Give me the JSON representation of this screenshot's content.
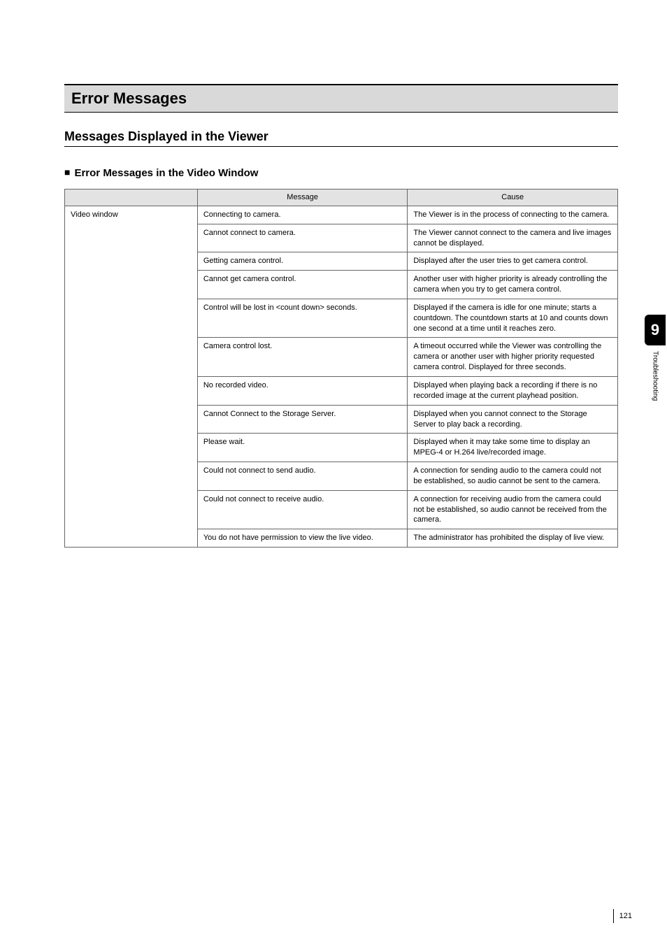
{
  "section_title": "Error Messages",
  "subsection_title": "Messages Displayed in the Viewer",
  "subsub_title": "Error Messages in the Video Window",
  "table": {
    "headers": [
      "",
      "Message",
      "Cause"
    ],
    "group_label": "Video window",
    "rows": [
      {
        "message": "Connecting to camera.",
        "cause": "The Viewer is in the process of connecting to the camera."
      },
      {
        "message": "Cannot connect to camera.",
        "cause": "The Viewer cannot connect to the camera and live images cannot be displayed."
      },
      {
        "message": "Getting camera control.",
        "cause": "Displayed after the user tries to get camera control."
      },
      {
        "message": "Cannot get camera control.",
        "cause": "Another user with higher priority is already controlling the camera when you try to get camera control."
      },
      {
        "message": "Control will be lost in <count down> seconds.",
        "cause": "Displayed if the camera is idle for one minute; starts a countdown. The countdown starts at 10 and counts down one second at a time until it reaches zero."
      },
      {
        "message": "Camera control lost.",
        "cause": "A timeout occurred while the Viewer was controlling the camera or another user with higher priority requested camera control. Displayed for three seconds."
      },
      {
        "message": "No recorded video.",
        "cause": "Displayed when playing back a recording if there is no recorded image at the current playhead position."
      },
      {
        "message": "Cannot Connect to the Storage Server.",
        "cause": "Displayed when you cannot connect to the Storage Server to play back a recording."
      },
      {
        "message": "Please wait.",
        "cause": "Displayed when it may take some time to display an MPEG-4 or H.264 live/recorded image."
      },
      {
        "message": "Could not connect to send audio.",
        "cause": "A connection for sending audio to the camera could not be established, so audio cannot be sent to the camera."
      },
      {
        "message": "Could not connect to receive audio.",
        "cause": "A connection for receiving audio from the camera could not be established, so audio cannot be received from the camera."
      },
      {
        "message": "You do not have permission to view the live video.",
        "cause": "The administrator has prohibited the display of live view."
      }
    ]
  },
  "side_tab": {
    "number": "9",
    "label": "Troubleshooting"
  },
  "page_number": "121"
}
